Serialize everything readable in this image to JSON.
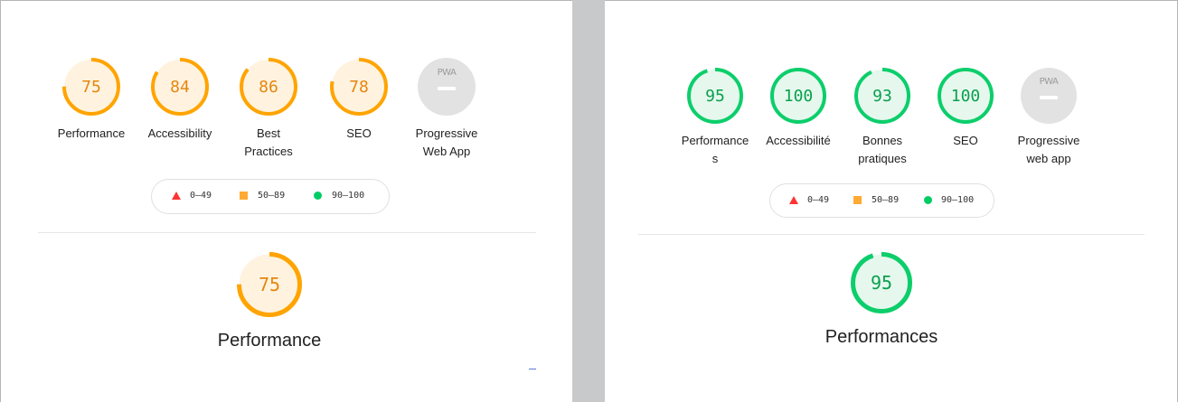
{
  "left": {
    "scores": [
      {
        "value": "75",
        "label": "Performance",
        "fraction": 0.75
      },
      {
        "value": "84",
        "label": "Accessibility",
        "fraction": 0.84
      },
      {
        "value": "86",
        "label_line1": "Best",
        "label_line2": "Practices",
        "fraction": 0.86
      },
      {
        "value": "78",
        "label": "SEO",
        "fraction": 0.78
      }
    ],
    "pwa": {
      "badge": "PWA",
      "label_line1": "Progressive",
      "label_line2": "Web App"
    },
    "legend": {
      "fail": "0–49",
      "average": "50–89",
      "pass": "90–100"
    },
    "focus": {
      "value": "75",
      "title": "Performance",
      "fraction": 0.75
    }
  },
  "right": {
    "scores": [
      {
        "value": "95",
        "label_line1": "Performance",
        "label_line2": "s",
        "fraction": 0.95
      },
      {
        "value": "100",
        "label": "Accessibilité",
        "fraction": 1.0
      },
      {
        "value": "93",
        "label_line1": "Bonnes",
        "label_line2": "pratiques",
        "fraction": 0.93
      },
      {
        "value": "100",
        "label": "SEO",
        "fraction": 1.0
      }
    ],
    "pwa": {
      "badge": "PWA",
      "label_line1": "Progressive",
      "label_line2": "web app"
    },
    "legend": {
      "fail": "0–49",
      "average": "50–89",
      "pass": "90–100"
    },
    "focus": {
      "value": "95",
      "title": "Performances",
      "fraction": 0.95
    }
  },
  "colors": {
    "orange_stroke": "#ffa400",
    "orange_fill": "#fff3e0",
    "orange_text": "#e6860d",
    "green_stroke": "#0cce6b",
    "green_fill": "#e6f8ee",
    "green_text": "#0aa04d",
    "fail": "#ff3333",
    "average": "#ffaa33",
    "pass": "#00cc66"
  }
}
